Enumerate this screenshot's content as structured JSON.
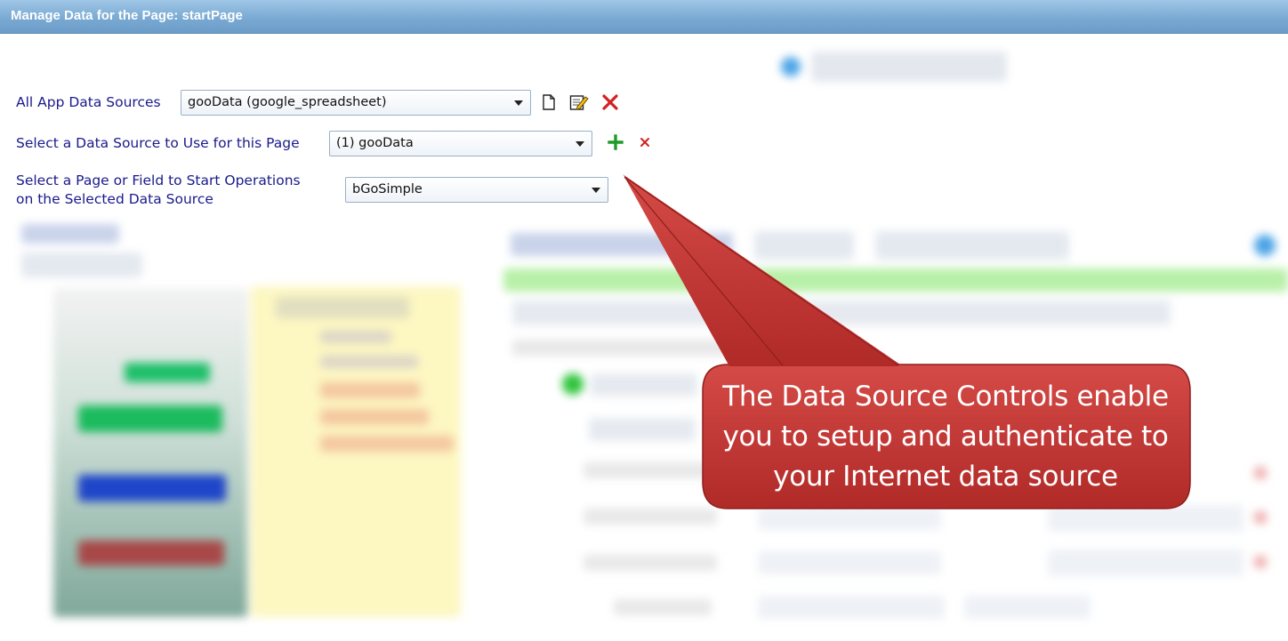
{
  "window": {
    "title": "Manage Data for the Page: startPage"
  },
  "all_sources": {
    "label": "All App Data Sources",
    "value": "gooData (google_spreadsheet)",
    "new_icon": "new-document-icon",
    "edit_icon": "edit-icon",
    "delete_icon": "delete-x-icon"
  },
  "page_source": {
    "label": "Select a Data Source to Use for this Page",
    "value": "(1) gooData",
    "add_icon": "plus-icon",
    "remove_icon": "small-x-icon"
  },
  "start_ops": {
    "label_line1": "Select a Page or Field to Start Operations",
    "label_line2": "on the Selected Data Source",
    "value": "bGoSimple"
  },
  "callout": {
    "line1": "The Data Source Controls enable",
    "line2": "you to setup and authenticate to",
    "line3": "your Internet data source"
  },
  "colors": {
    "title_bar": "#7aaad3",
    "label_text": "#1a1a8c",
    "callout_fill": "#c03432",
    "delete_red": "#d42020",
    "plus_green": "#1f9a2a"
  }
}
